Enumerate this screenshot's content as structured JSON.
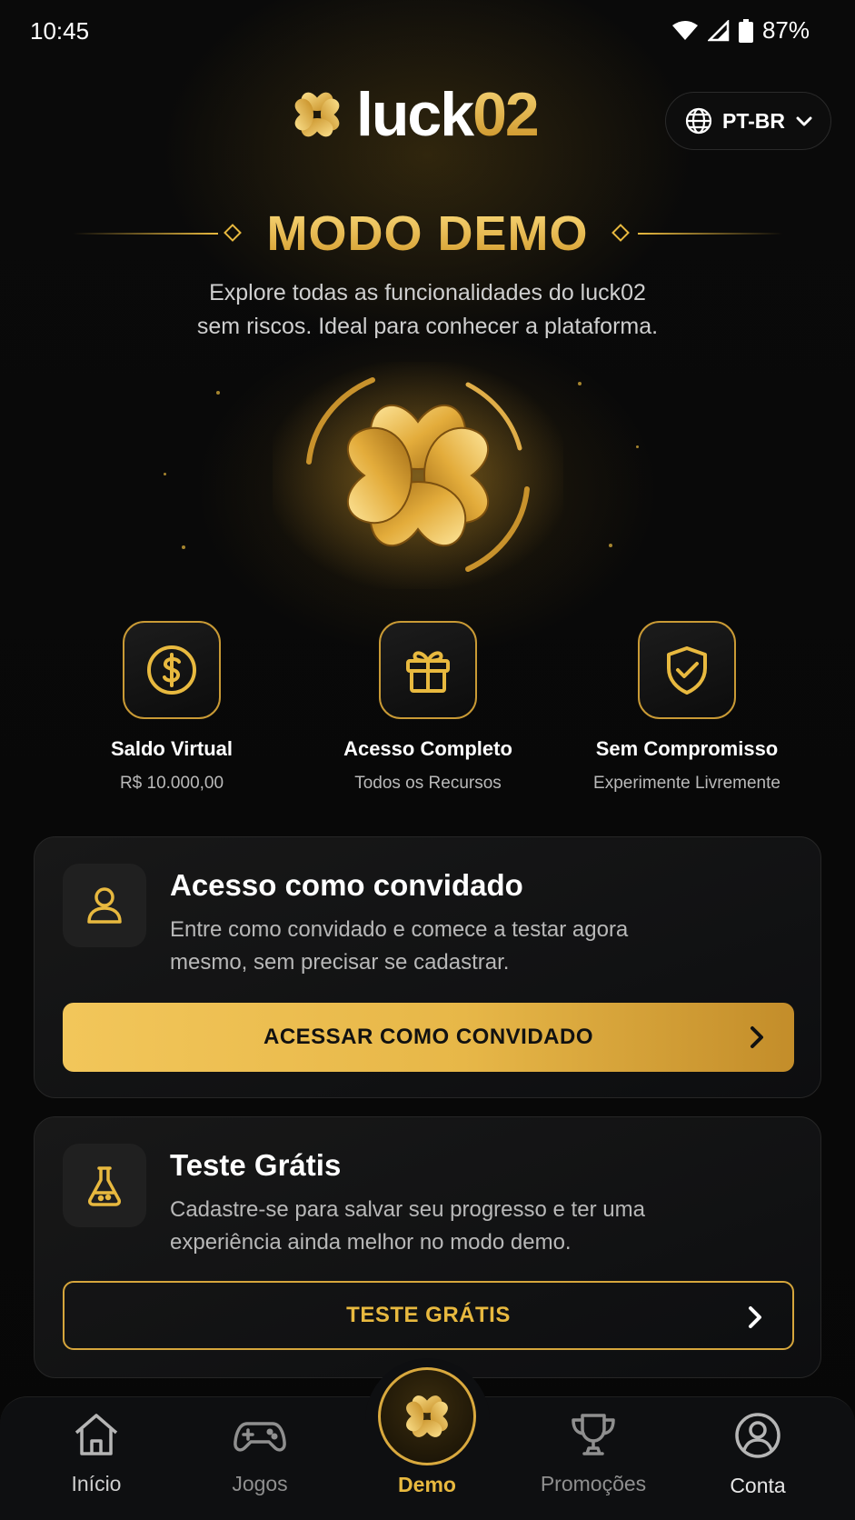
{
  "status_bar": {
    "time": "10:45",
    "battery": "87%"
  },
  "header": {
    "logo_part1": "luck",
    "logo_part2": "02",
    "language": "PT-BR"
  },
  "hero": {
    "title": "MODO DEMO",
    "subtitle_line1": "Explore todas as funcionalidades do luck02",
    "subtitle_line2": "sem riscos. Ideal para conhecer a plataforma."
  },
  "features": [
    {
      "icon": "dollar-coin-icon",
      "title": "Saldo Virtual",
      "subtitle": "R$ 10.000,00"
    },
    {
      "icon": "gift-icon",
      "title": "Acesso Completo",
      "subtitle": "Todos os Recursos"
    },
    {
      "icon": "shield-check-icon",
      "title": "Sem Compromisso",
      "subtitle": "Experimente Livremente"
    }
  ],
  "cards": [
    {
      "icon": "user-icon",
      "title": "Acesso como convidado",
      "description": "Entre como convidado e comece a testar agora mesmo, sem precisar se cadastrar.",
      "button": "ACESSAR COMO CONVIDADO"
    },
    {
      "icon": "flask-icon",
      "title": "Teste Grátis",
      "description": "Cadastre-se para salvar seu progresso e ter uma experiência ainda melhor no modo demo.",
      "button": "TESTE GRÁTIS"
    }
  ],
  "bottom_nav": {
    "items": [
      {
        "label": "Início",
        "icon": "home-icon"
      },
      {
        "label": "Jogos",
        "icon": "gamepad-icon"
      },
      {
        "label": "Demo",
        "icon": "clover-icon",
        "active": true
      },
      {
        "label": "Promoções",
        "icon": "trophy-icon"
      },
      {
        "label": "Conta",
        "icon": "account-icon"
      }
    ]
  },
  "colors": {
    "accent": "#e8b93f",
    "background": "#070707",
    "card": "#141414"
  }
}
